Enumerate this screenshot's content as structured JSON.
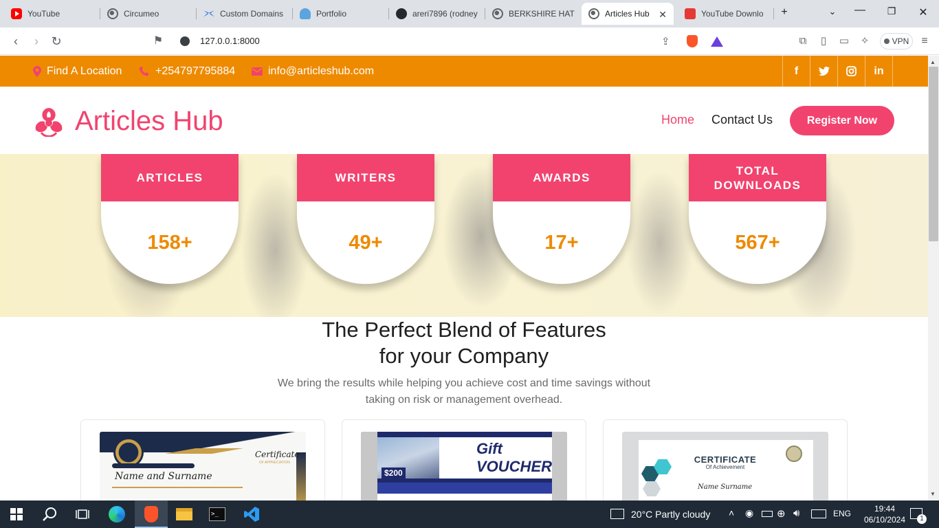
{
  "browser": {
    "tabs": [
      {
        "title": "YouTube",
        "icon": "youtube-icon",
        "active": false
      },
      {
        "title": "Circumeo",
        "icon": "globe-icon",
        "active": false
      },
      {
        "title": "Custom Domains",
        "icon": "custom-domains-icon",
        "active": false
      },
      {
        "title": "Portfolio",
        "icon": "portfolio-icon",
        "active": false
      },
      {
        "title": "areri7896 (rodney",
        "icon": "github-icon",
        "active": false
      },
      {
        "title": "BERKSHIRE HATH",
        "icon": "globe-icon",
        "active": false
      },
      {
        "title": "Articles Hub",
        "icon": "globe-icon",
        "active": true
      },
      {
        "title": "YouTube Downlo",
        "icon": "download-icon",
        "active": false
      }
    ],
    "url": "127.0.0.1:8000",
    "vpn_label": "VPN"
  },
  "page": {
    "topbar": {
      "location": "Find A Location",
      "phone": "+254797795884",
      "email": "info@articleshub.com",
      "social": [
        "f",
        "🐦",
        "◎",
        "in"
      ]
    },
    "brand": "Articles Hub",
    "nav": {
      "home": "Home",
      "contact": "Contact Us",
      "register": "Register Now"
    },
    "stats": [
      {
        "label": "ARTICLES",
        "value": "158+"
      },
      {
        "label": "WRITERS",
        "value": "49+"
      },
      {
        "label": "AWARDS",
        "value": "17+"
      },
      {
        "label": "TOTAL DOWNLOADS",
        "value": "567+"
      }
    ],
    "features": {
      "title_line1": "The Perfect Blend of Features",
      "title_line2": "for your Company",
      "subtitle_line1": "We bring the results while helping you achieve cost and time savings without",
      "subtitle_line2": "taking on risk or management overhead."
    },
    "cards": {
      "cert1": {
        "heading": "Certificate",
        "sub": "OF APPRECIATION",
        "name": "Name and Surname"
      },
      "voucher": {
        "title": "Gift VOUCHER",
        "price": "$200"
      },
      "cert3": {
        "heading": "CERTIFICATE",
        "sub": "Of Achievement",
        "name": "Name Surname"
      }
    },
    "colors": {
      "accent_pink": "#f1436e",
      "accent_orange": "#ee8a00"
    }
  },
  "taskbar": {
    "weather": "20°C  Partly cloudy",
    "lang": "ENG",
    "time": "19:44",
    "date": "06/10/2024",
    "notifications": "1"
  }
}
